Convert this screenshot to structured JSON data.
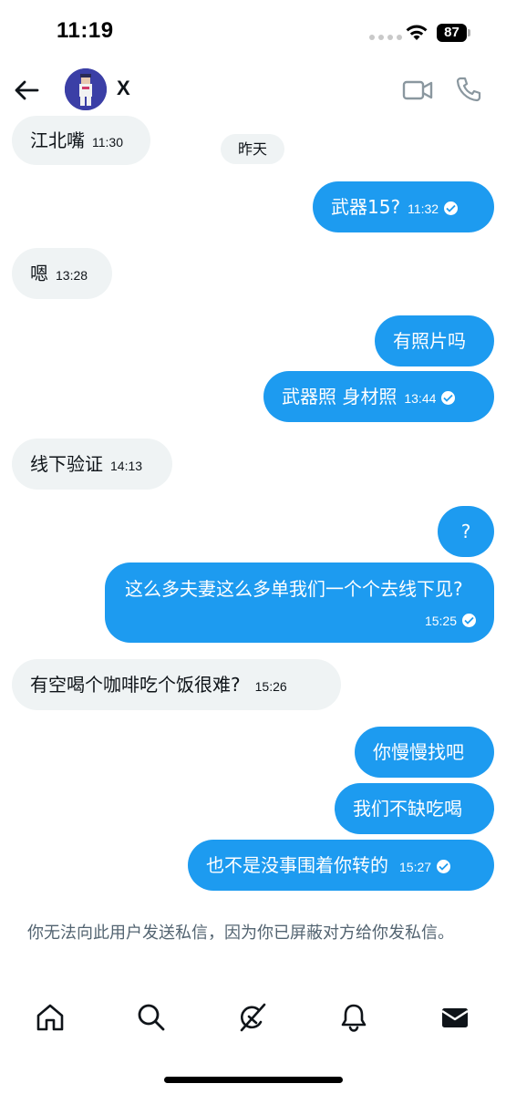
{
  "status_bar": {
    "time": "11:19",
    "battery": "87"
  },
  "header": {
    "contact_name": "X"
  },
  "date_separator": "昨天",
  "messages": [
    {
      "dir": "in",
      "text": "江北嘴",
      "time": "11:30"
    },
    {
      "dir": "out",
      "text": "武器15?",
      "time": "11:32",
      "read": true
    },
    {
      "dir": "in",
      "text": "嗯",
      "time": "13:28"
    },
    {
      "dir": "out",
      "text": "有照片吗",
      "time": ""
    },
    {
      "dir": "out",
      "text": "武器照 身材照",
      "time": "13:44",
      "read": true
    },
    {
      "dir": "in",
      "text": "线下验证",
      "time": "14:13"
    },
    {
      "dir": "out",
      "text": "?",
      "time": ""
    },
    {
      "dir": "out",
      "text": "这么多夫妻这么多单我们一个个去线下见?",
      "time": "15:25",
      "read": true
    },
    {
      "dir": "in",
      "text": "有空喝个咖啡吃个饭很难?",
      "time": "15:26"
    },
    {
      "dir": "out",
      "text": "你慢慢找吧",
      "time": ""
    },
    {
      "dir": "out",
      "text": "我们不缺吃喝",
      "time": ""
    },
    {
      "dir": "out",
      "text": "也不是没事围着你转的",
      "time": "15:27",
      "read": true
    }
  ],
  "notice": "你无法向此用户发送私信，因为你已屏蔽对方给你发私信。",
  "bottom_nav": [
    {
      "icon": "home-icon"
    },
    {
      "icon": "search-icon"
    },
    {
      "icon": "grok-icon"
    },
    {
      "icon": "bell-icon"
    },
    {
      "icon": "mail-icon"
    }
  ],
  "colors": {
    "accent": "#1d9bf0",
    "incoming_bubble": "#eff3f4",
    "notice_text": "#536471"
  }
}
